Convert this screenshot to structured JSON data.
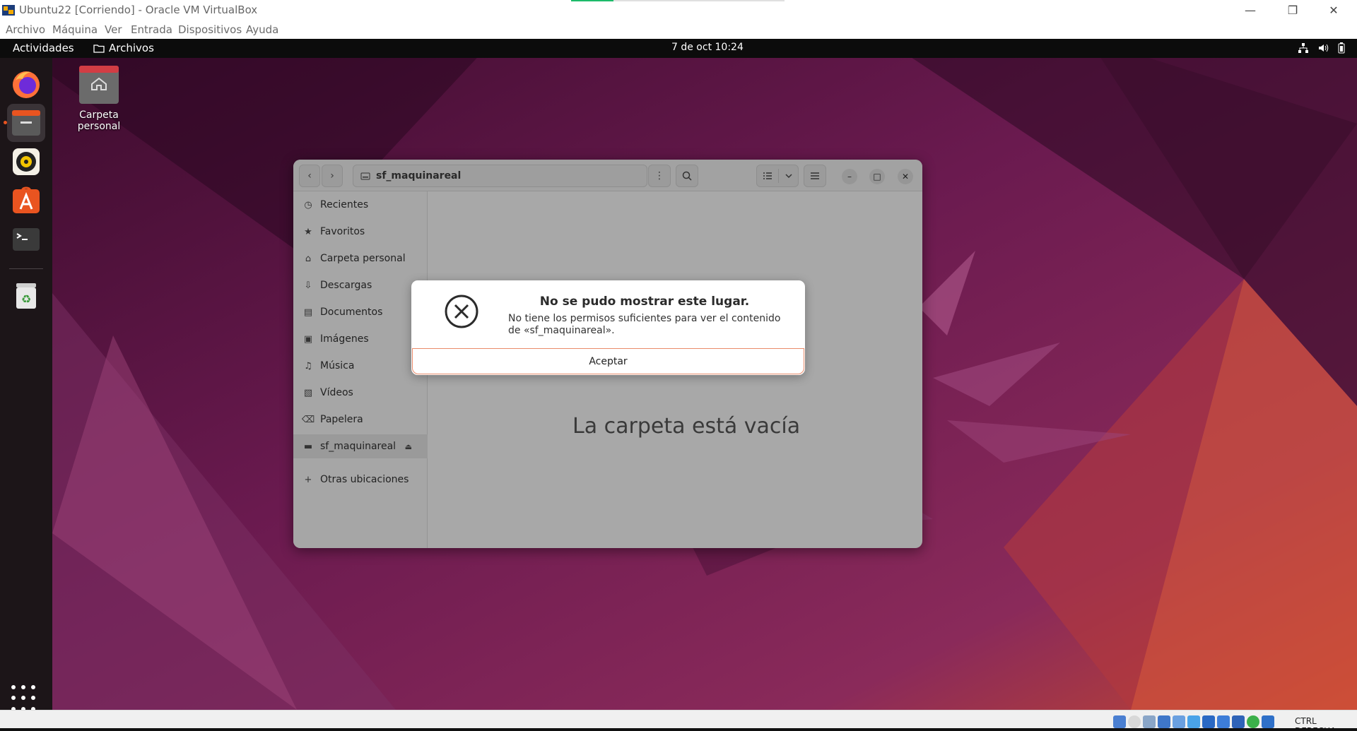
{
  "host": {
    "title": "Ubuntu22 [Corriendo] - Oracle VM VirtualBox",
    "progress": 0.2,
    "menu": [
      "Archivo",
      "Máquina",
      "Ver",
      "Entrada",
      "Dispositivos",
      "Ayuda"
    ],
    "status_label": "CTRL DERECHA"
  },
  "gnome": {
    "activities": "Actividades",
    "app_name": "Archivos",
    "clock": "7 de oct  10:24"
  },
  "desktop": {
    "home_label": "Carpeta personal"
  },
  "dock": {
    "items": [
      "firefox-icon",
      "files-icon",
      "rhythmbox-icon",
      "app-center-icon",
      "terminal-icon",
      "trash-icon"
    ]
  },
  "files": {
    "path": "sf_maquinareal",
    "sidebar": [
      {
        "label": "Recientes",
        "icon": "clock-icon"
      },
      {
        "label": "Favoritos",
        "icon": "star-icon"
      },
      {
        "label": "Carpeta personal",
        "icon": "home-icon"
      },
      {
        "label": "Descargas",
        "icon": "download-icon"
      },
      {
        "label": "Documentos",
        "icon": "document-icon"
      },
      {
        "label": "Imágenes",
        "icon": "image-icon"
      },
      {
        "label": "Música",
        "icon": "music-icon"
      },
      {
        "label": "Vídeos",
        "icon": "video-icon"
      },
      {
        "label": "Papelera",
        "icon": "trash-icon"
      },
      {
        "label": "sf_maquinareal",
        "icon": "drive-icon"
      }
    ],
    "other_locations": "Otras ubicaciones",
    "empty_text": "La carpeta está vacía"
  },
  "dialog": {
    "title": "No se pudo mostrar este lugar.",
    "message": "No tiene los permisos suficientes para ver el contenido de «sf_maquinareal».",
    "button": "Aceptar"
  },
  "colors": {
    "accent": "#e95420",
    "topbar": "#0c0c0c",
    "dock": "#1c1518"
  }
}
